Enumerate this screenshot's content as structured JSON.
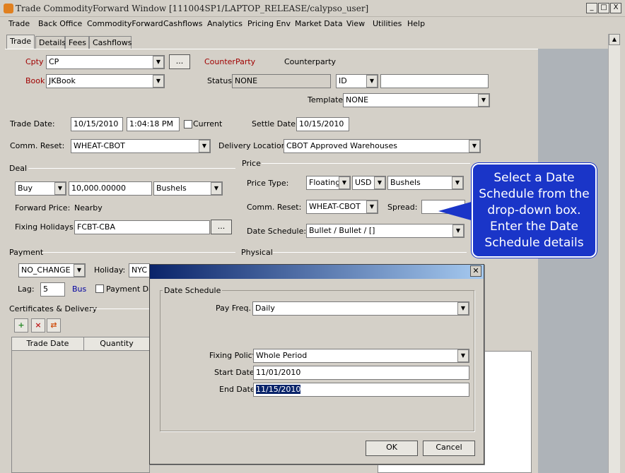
{
  "window": {
    "title": "Trade CommodityForward Window  [111004SP1/LAPTOP_RELEASE/calypso_user]",
    "min": "_",
    "max": "□",
    "close": "X"
  },
  "menu": [
    "Trade",
    "Back Office",
    "CommodityForward",
    "Cashflows",
    "Analytics",
    "Pricing Env",
    "Market Data",
    "View",
    "Utilities",
    "Help"
  ],
  "tabs": [
    "Trade",
    "Details",
    "Fees",
    "Cashflows"
  ],
  "trade": {
    "cpty_label": "Cpty",
    "cpty_value": "CP",
    "ellipsis": "...",
    "counterparty_label": "CounterParty",
    "counterparty_value": "Counterparty",
    "book_label": "Book",
    "book_value": "JKBook",
    "status_label": "Status",
    "status_value": "NONE",
    "id_type": "ID",
    "id_value": "",
    "template_label": "Template",
    "template_value": "NONE",
    "trade_date_label": "Trade Date:",
    "trade_date": "10/15/2010",
    "trade_time": "1:04:18 PM",
    "current_label": "Current",
    "settle_date_label": "Settle Date:",
    "settle_date": "10/15/2010",
    "comm_reset_label": "Comm. Reset:",
    "comm_reset_value": "WHEAT-CBOT",
    "delivery_location_label": "Delivery Location:",
    "delivery_location_value": "CBOT Approved Warehouses"
  },
  "deal": {
    "group_label": "Deal",
    "direction": "Buy",
    "quantity": "10,000.00000",
    "unit": "Bushels",
    "forward_price_label": "Forward Price:",
    "forward_price_value": "Nearby",
    "fixing_holidays_label": "Fixing Holidays:",
    "fixing_holidays_value": "FCBT-CBA"
  },
  "price": {
    "group_label": "Price",
    "price_type_label": "Price Type:",
    "price_type": "Floating",
    "currency": "USD",
    "unit": "Bushels",
    "comm_reset_label": "Comm. Reset:",
    "comm_reset_value": "WHEAT-CBOT",
    "spread_label": "Spread:",
    "spread_value": "",
    "date_schedule_label": "Date Schedule:",
    "date_schedule_value": "Bullet / Bullet / []"
  },
  "payment": {
    "group_label": "Payment",
    "roll": "NO_CHANGE",
    "holiday_label": "Holiday:",
    "holiday_value": "NYC",
    "lag_label": "Lag:",
    "lag_value": "5",
    "bus_label": "Bus",
    "payment_day_label": "Payment Da"
  },
  "physical": {
    "group_label": "Physical"
  },
  "certificates": {
    "group_label": "Certificates & Delivery",
    "columns": [
      "Trade Date",
      "Quantity"
    ]
  },
  "dialog": {
    "group_label": "Date Schedule",
    "pay_freq_label": "Pay Freq.",
    "pay_freq_value": "Daily",
    "fixing_policy_label": "Fixing Policy",
    "fixing_policy_value": "Whole Period",
    "start_date_label": "Start Date",
    "start_date_value": "11/01/2010",
    "end_date_label": "End Date",
    "end_date_value": "11/15/2010",
    "ok_label": "OK",
    "cancel_label": "Cancel"
  },
  "callout": {
    "text": "Select a Date Schedule from the drop-down box. Enter the Date Schedule details"
  }
}
